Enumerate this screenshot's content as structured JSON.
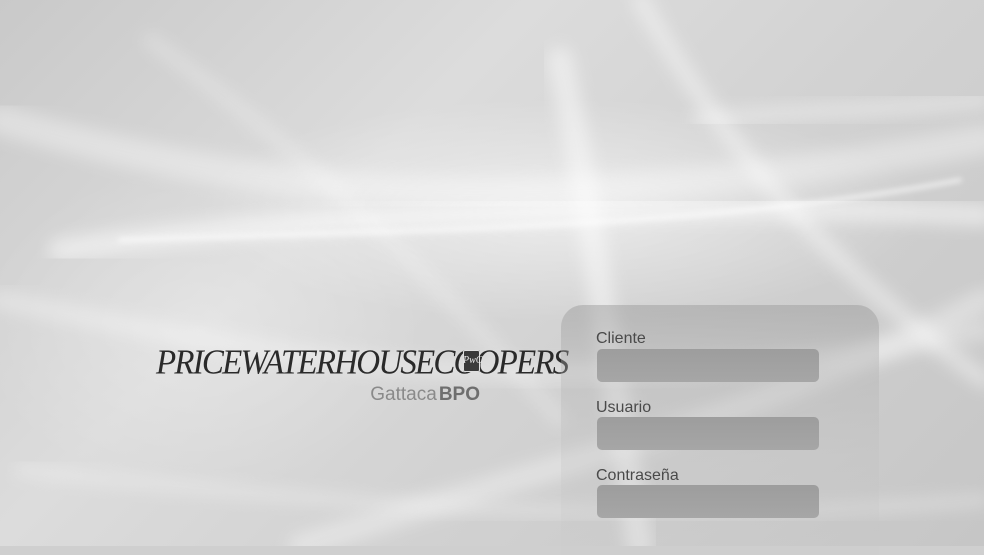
{
  "brand": {
    "name": "PRICEWATERHOUSECOOPERS",
    "emblem": "PwC",
    "subbrand_light": "Gattaca",
    "subbrand_bold": "BPO"
  },
  "login": {
    "fields": [
      {
        "label": "Cliente",
        "value": "",
        "placeholder": ""
      },
      {
        "label": "Usuario",
        "value": "",
        "placeholder": ""
      },
      {
        "label": "Contraseña",
        "value": "",
        "placeholder": ""
      }
    ]
  },
  "colors": {
    "background": "#cfcfcf",
    "input": "#a2a2a2",
    "label": "#4a4a4a",
    "logo": "#2a2a2a"
  }
}
